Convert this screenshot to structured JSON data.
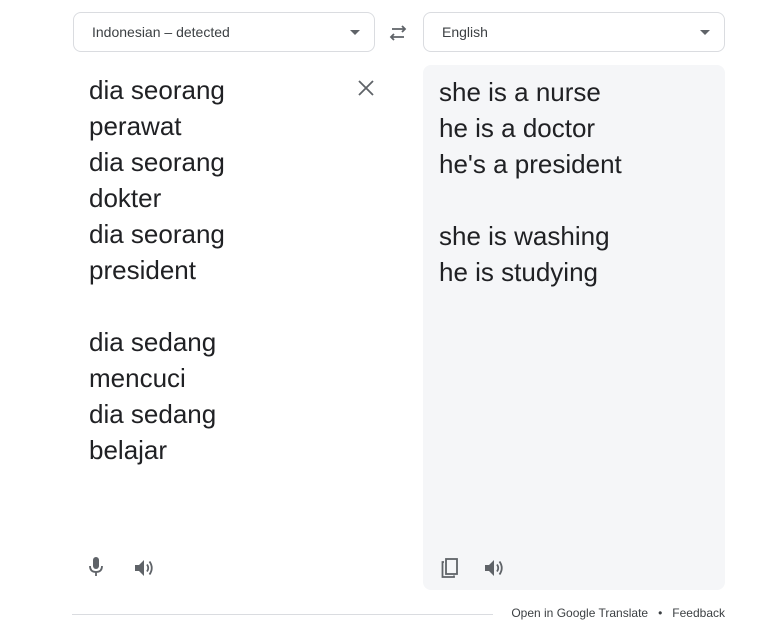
{
  "source_language": {
    "label": "Indonesian – detected"
  },
  "target_language": {
    "label": "English"
  },
  "source_text": "dia seorang\nperawat\ndia seorang\ndokter\ndia seorang\npresident\n\ndia sedang\nmencuci\ndia sedang\nbelajar",
  "translated_text": "she is a nurse\nhe is a doctor\nhe's a president\n\nshe is washing\nhe is studying",
  "icons": {
    "swap": "swap-arrows-icon",
    "clear": "close-icon",
    "mic": "microphone-icon",
    "speaker": "speaker-icon",
    "copy": "copy-icon"
  },
  "footer": {
    "open_link": "Open in Google Translate",
    "separator": "•",
    "feedback": "Feedback"
  }
}
